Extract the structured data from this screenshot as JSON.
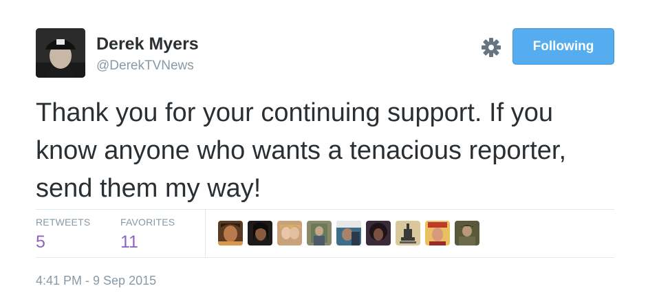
{
  "author": {
    "display_name": "Derek Myers",
    "handle": "@DerekTVNews",
    "avatar_icon": "profile-photo"
  },
  "actions": {
    "settings_icon": "gear-icon",
    "follow_label": "Following",
    "follow_color": "#55acee"
  },
  "tweet": {
    "text": "Thank you for your continuing support. If you know anyone who wants a tenacious reporter, send them my way!",
    "timestamp": "4:41 PM - 9 Sep 2015"
  },
  "stats": {
    "retweets_label": "RETWEETS",
    "retweets_count": "5",
    "favorites_label": "FAVORITES",
    "favorites_count": "11",
    "count_color": "#8e62c6"
  },
  "favoriters": [
    {
      "icon": "user-avatar-1"
    },
    {
      "icon": "user-avatar-2"
    },
    {
      "icon": "user-avatar-3"
    },
    {
      "icon": "user-avatar-4"
    },
    {
      "icon": "user-avatar-5"
    },
    {
      "icon": "user-avatar-6"
    },
    {
      "icon": "user-avatar-7"
    },
    {
      "icon": "user-avatar-8"
    },
    {
      "icon": "user-avatar-9"
    }
  ]
}
